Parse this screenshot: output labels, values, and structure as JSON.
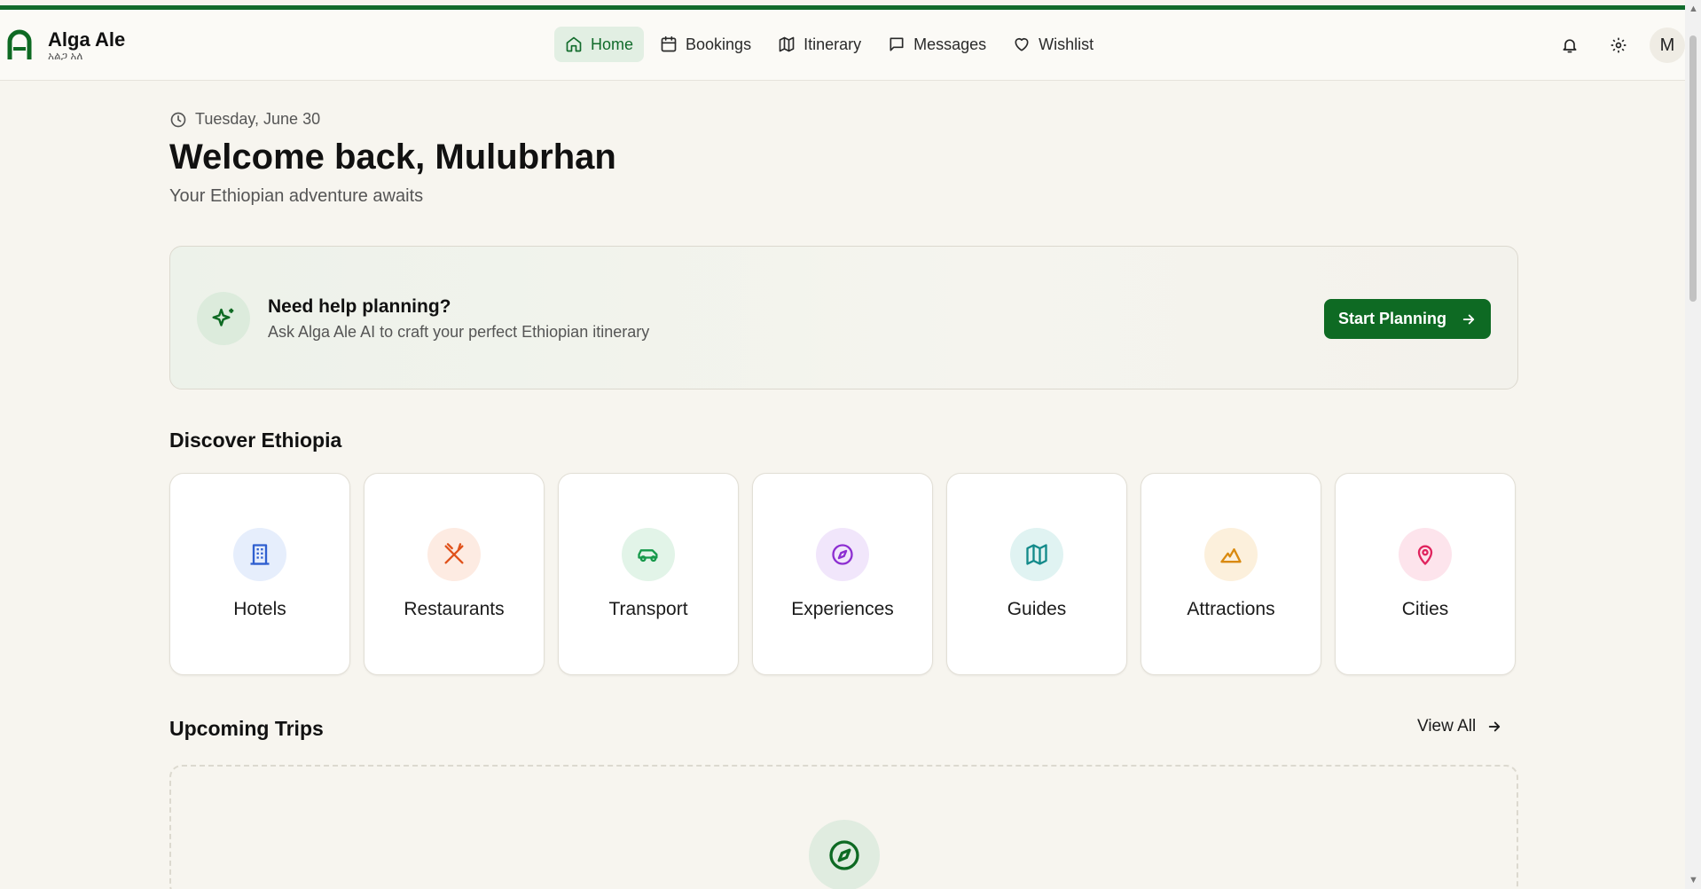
{
  "brand": {
    "name": "Alga Ale",
    "subtitle": "አልጋ አለ"
  },
  "nav": {
    "items": [
      {
        "label": "Home",
        "icon": "home-icon",
        "active": true
      },
      {
        "label": "Bookings",
        "icon": "calendar-icon"
      },
      {
        "label": "Itinerary",
        "icon": "map-icon"
      },
      {
        "label": "Messages",
        "icon": "message-icon"
      },
      {
        "label": "Wishlist",
        "icon": "heart-icon"
      }
    ],
    "avatar_initial": "M"
  },
  "header": {
    "date": "Tuesday, June 30",
    "welcome": "Welcome back, Mulubrhan",
    "tagline": "Your Ethiopian adventure awaits"
  },
  "help_card": {
    "title": "Need help planning?",
    "subtitle": "Ask Alga Ale AI to craft your perfect Ethiopian itinerary",
    "button_label": "Start Planning"
  },
  "discover": {
    "title": "Discover Ethiopia",
    "categories": [
      {
        "label": "Hotels",
        "icon": "building-icon",
        "color": "#2f5fd0",
        "bg": "#e6eefc"
      },
      {
        "label": "Restaurants",
        "icon": "utensils-icon",
        "color": "#e0521b",
        "bg": "#fdebe2"
      },
      {
        "label": "Transport",
        "icon": "car-icon",
        "color": "#16994a",
        "bg": "#e2f4e8"
      },
      {
        "label": "Experiences",
        "icon": "compass-icon",
        "color": "#8d2fd1",
        "bg": "#f1e6fb"
      },
      {
        "label": "Guides",
        "icon": "map-icon",
        "color": "#138a8a",
        "bg": "#e0f3f2"
      },
      {
        "label": "Attractions",
        "icon": "mountain-icon",
        "color": "#d98a10",
        "bg": "#fcf0dc"
      },
      {
        "label": "Cities",
        "icon": "map-pin-icon",
        "color": "#e0245e",
        "bg": "#fde4ec"
      }
    ]
  },
  "upcoming": {
    "title": "Upcoming Trips",
    "view_all": "View All"
  },
  "colors": {
    "primary": "#0e6a23",
    "active_bg": "#e2efe3",
    "page_bg": "#f7f5ef"
  }
}
